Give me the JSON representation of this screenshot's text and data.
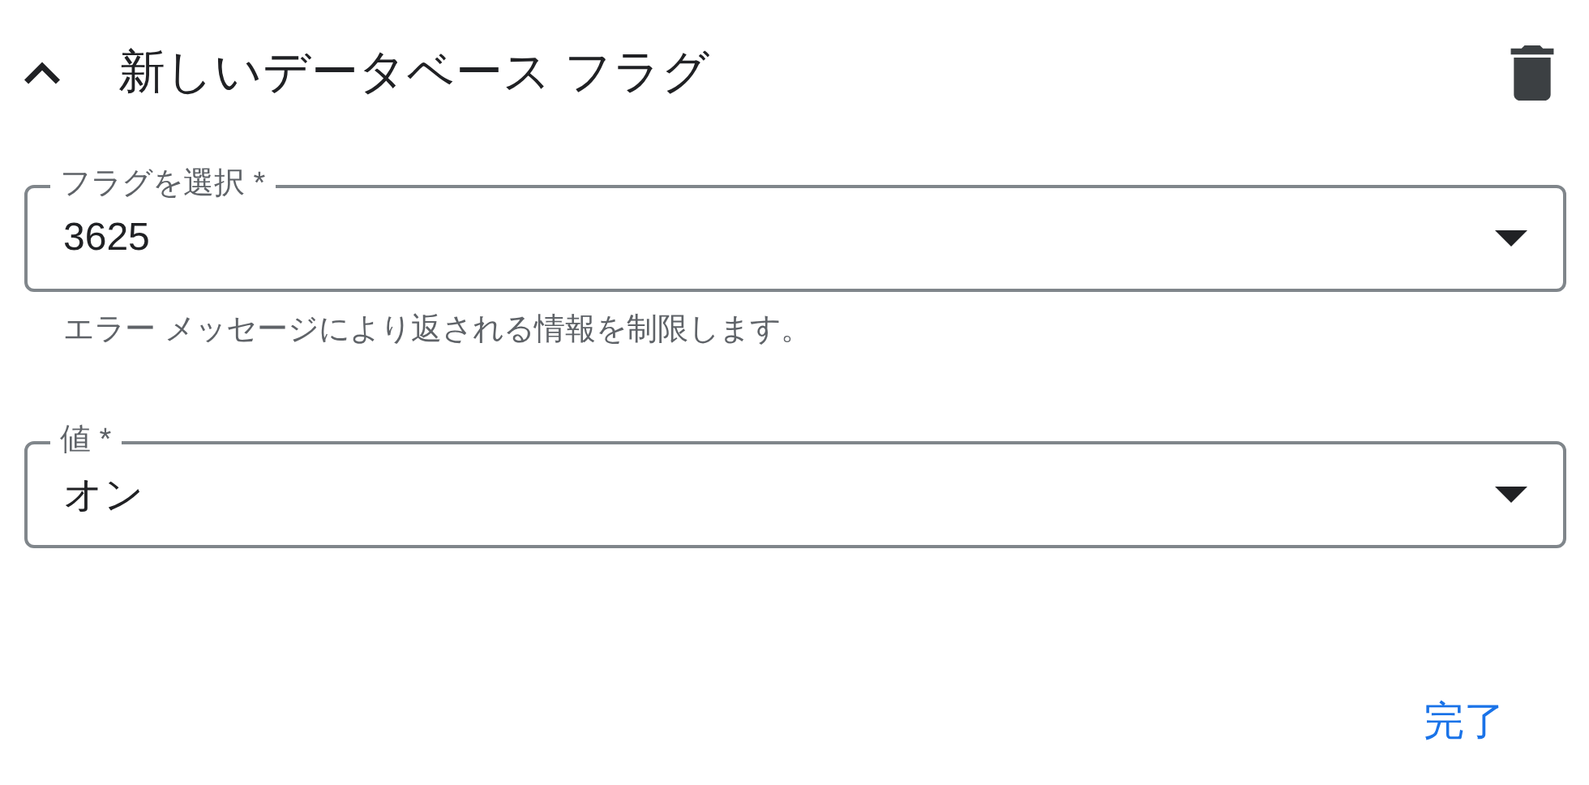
{
  "header": {
    "title": "新しいデータベース フラグ",
    "expanded": true
  },
  "fields": [
    {
      "label": "フラグを選択 *",
      "value": "3625",
      "helper": "エラー メッセージにより返される情報を制限します。"
    },
    {
      "label": "値 *",
      "value": "オン"
    }
  ],
  "buttons": [
    "完了"
  ]
}
